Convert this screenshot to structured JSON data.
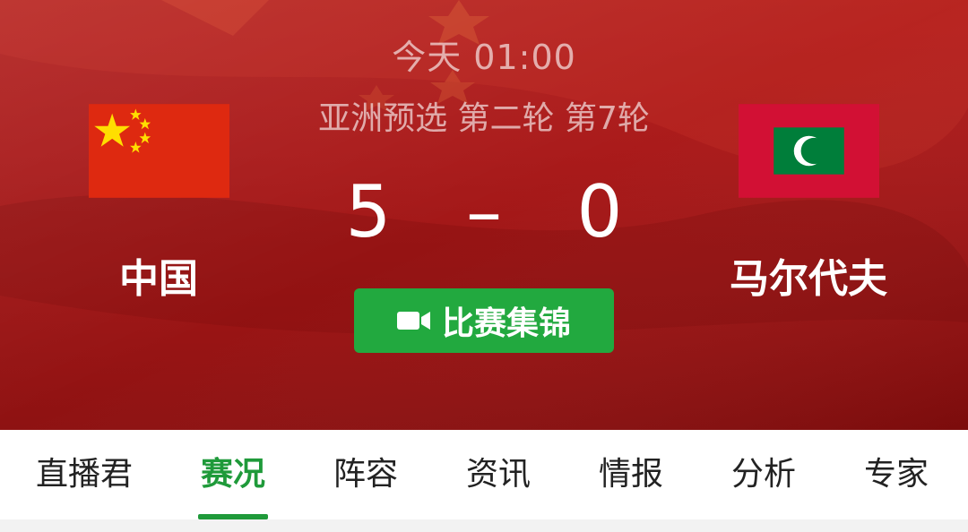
{
  "match": {
    "time": "今天 01:00",
    "round": "亚洲预选 第二轮 第7轮",
    "home_team": "中国",
    "away_team": "马尔代夫",
    "home_score": "5",
    "separator": "–",
    "away_score": "0",
    "highlights_label": "比赛集锦"
  },
  "icons": {
    "highlights": "video-camera-icon",
    "home_flag": "china-flag-icon",
    "away_flag": "maldives-flag-icon"
  },
  "tabs": [
    {
      "label": "直播君",
      "active": false
    },
    {
      "label": "赛况",
      "active": true
    },
    {
      "label": "阵容",
      "active": false
    },
    {
      "label": "资讯",
      "active": false
    },
    {
      "label": "情报",
      "active": false
    },
    {
      "label": "分析",
      "active": false
    },
    {
      "label": "专家",
      "active": false
    }
  ],
  "colors": {
    "hero_red": "#a81616",
    "accent_green": "#1f9a3a",
    "button_green": "#22a93f"
  }
}
